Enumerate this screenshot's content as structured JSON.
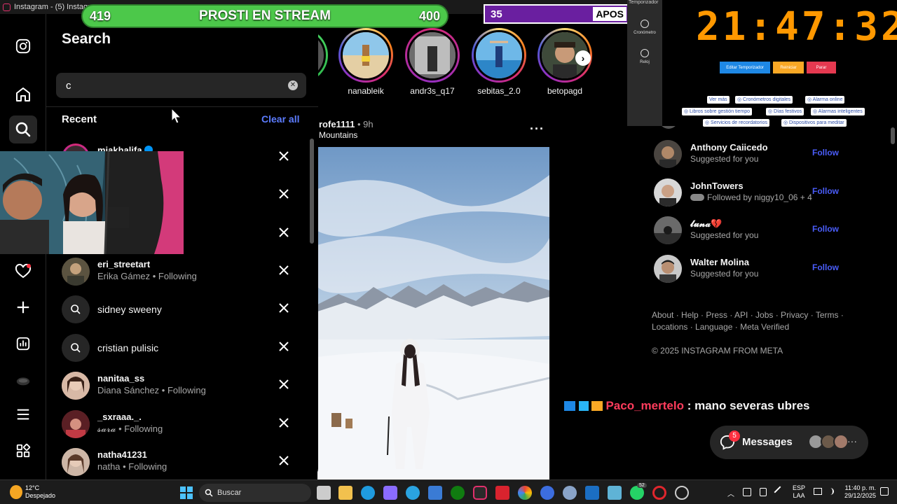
{
  "window": {
    "title": "Instagram - (5) Instagram"
  },
  "overlays": {
    "progress_left": "419",
    "progress_title": "PROSTI EN STREAM",
    "progress_right": "400",
    "purple_left": "35",
    "purple_right": "APOS",
    "chat_user": "Paco_mertelo",
    "chat_message": ": mano severas ubres"
  },
  "timer": {
    "header": "Temporizador",
    "side_items": [
      "Cronómetro",
      "Reloj"
    ],
    "clock": "21:47:32",
    "buttons": [
      "Editar Temporizador",
      "Reiniciar",
      "Parar"
    ],
    "button_colors": [
      "#1e88e5",
      "#f9a825",
      "#e53950"
    ],
    "links": [
      "Ver más",
      "◎ Cronómetros digitales",
      "◎ Alarma online",
      "◎ Libros sobre gestión tiempo",
      "◎ Días festivos",
      "◎ Alarmas inteligentes",
      "◎ Servicios de recordatorios",
      "◎ Dispositivos para meditar"
    ]
  },
  "search": {
    "title": "Search",
    "query": "c",
    "recent_label": "Recent",
    "clear_all": "Clear all",
    "items": [
      {
        "name": "miakhalifa",
        "sub": "",
        "type": "user",
        "verified": true
      },
      {
        "name": "",
        "sub": "",
        "type": "user"
      },
      {
        "name": "",
        "sub": "",
        "type": "user"
      },
      {
        "name": "eri_streetart",
        "sub": "Erika Gámez • Following",
        "type": "user"
      },
      {
        "name": "sidney sweeny",
        "sub": "",
        "type": "search"
      },
      {
        "name": "cristian pulisic",
        "sub": "",
        "type": "search"
      },
      {
        "name": "nanitaa_ss",
        "sub": "Diana Sánchez • Following",
        "type": "user"
      },
      {
        "name": "_sxraaa._.",
        "sub": "𝓼𝓪𝓻𝓪 • Following",
        "type": "user"
      },
      {
        "name": "natha41231",
        "sub": "natha • Following",
        "type": "user"
      }
    ]
  },
  "stories": [
    {
      "label": "nanableik"
    },
    {
      "label": "andr3s_q17"
    },
    {
      "label": "sebitas_2.0"
    },
    {
      "label": "betopagd"
    }
  ],
  "post": {
    "user": "rofe1111",
    "time": " • 9h",
    "location": "Mountains"
  },
  "suggestions": [
    {
      "name": "Anthony Caiicedo",
      "sub": "Suggested for you",
      "follow": "Follow"
    },
    {
      "name": "JohnTowers",
      "sub": "Followed by niggy10_06 + 4",
      "follow": "Follow"
    },
    {
      "name": "𝓵𝓾𝓷𝓪💔",
      "sub": "Suggested for you",
      "follow": "Follow"
    },
    {
      "name": "Walter Molina",
      "sub": "Suggested for you",
      "follow": "Follow"
    }
  ],
  "footer": {
    "links1": "About · Help · Press · API · Jobs · Privacy · Terms ·",
    "links2": "Locations · Language · Meta Verified",
    "copyright": "© 2025 INSTAGRAM FROM META"
  },
  "messages": {
    "label": "Messages",
    "badge": "5"
  },
  "taskbar": {
    "temp": "12°C",
    "weather": "Despejado",
    "search": "Buscar",
    "lang1": "ESP",
    "lang2": "LAA",
    "time": "11:40 p. m.",
    "date": "29/12/2025",
    "badge_whatsapp": "52"
  },
  "colors": {
    "accent": "#0095f6",
    "follow": "#4a5df9",
    "clear_all": "#5c7cff",
    "timer_digits": "#ff9800"
  }
}
